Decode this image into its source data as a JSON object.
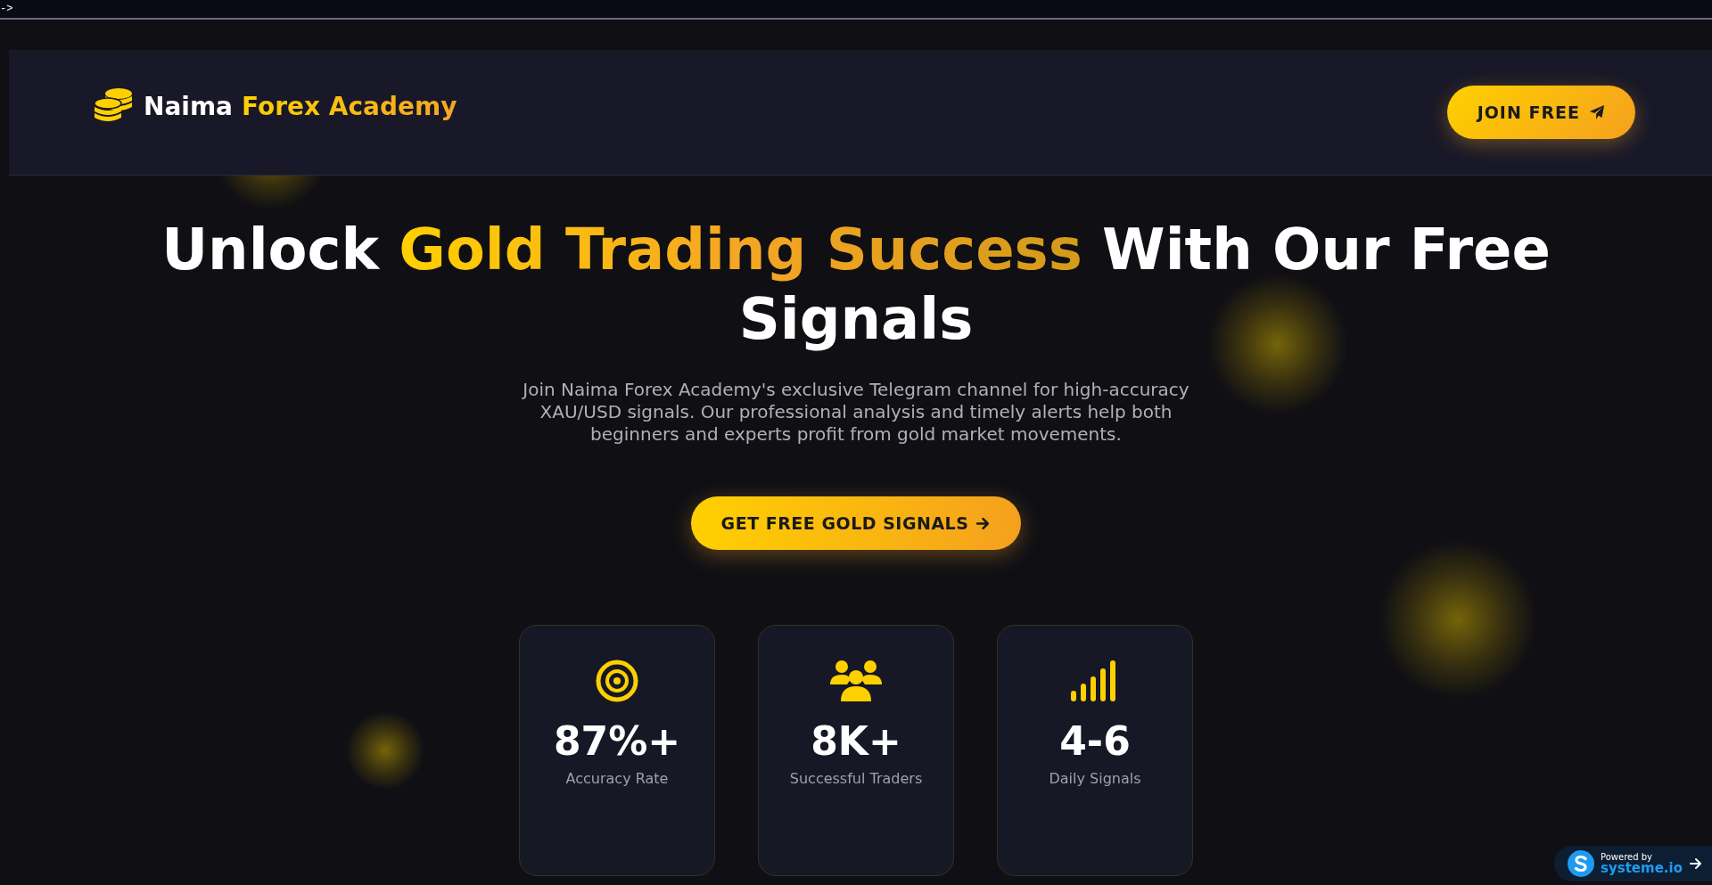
{
  "top_strip": {
    "text": "->"
  },
  "header": {
    "brand": {
      "first": "Naima",
      "second": "Forex Academy"
    },
    "join_button": "JOIN FREE"
  },
  "hero": {
    "headline": {
      "before": "Unlock ",
      "highlight": "Gold Trading Success",
      "after": " With Our Free Signals"
    },
    "description": "Join Naima Forex Academy's exclusive Telegram channel for high-accuracy XAU/USD signals. Our professional analysis and timely alerts help both beginners and experts profit from gold market movements.",
    "cta": "GET FREE GOLD SIGNALS"
  },
  "stats": [
    {
      "kind": "target",
      "value": "87%+",
      "label": "Accuracy Rate"
    },
    {
      "kind": "people",
      "value": "8K+",
      "label": "Successful Traders"
    },
    {
      "kind": "signal",
      "value": "4-6",
      "label": "Daily Signals"
    }
  ],
  "badge": {
    "line1": "Powered by",
    "line2": "systeme.io"
  }
}
